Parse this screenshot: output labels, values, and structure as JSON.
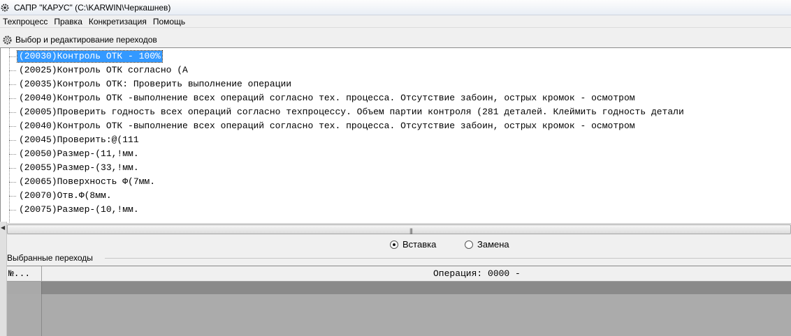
{
  "window": {
    "title": "САПР \"КАРУС\" (C:\\KARWIN\\Черкашнев)"
  },
  "menu": {
    "items": [
      "Техпроцесс",
      "Правка",
      "Конкретизация",
      "Помощь"
    ]
  },
  "panel": {
    "title": "Выбор и редактирование переходов"
  },
  "tree": {
    "rows": [
      "(20030)Контроль ОТК - 100%",
      "(20025)Контроль ОТК согласно (А",
      "(20035)Контроль ОТК: Проверить выполнение операции",
      "(20040)Контроль ОТК -выполнение всех операций согласно тех. процесса. Отсутствие забоин, острых кромок - осмотром",
      "(20005)Проверить годность всех операций согласно техпроцессу. Объем партии контроля (281 деталей. Клеймить годность детали",
      "(20040)Контроль ОТК -выполнение всех операций согласно тех. процесса. Отсутствие забоин, острых кромок - осмотром",
      "(20045)Проверить:@(111",
      "(20050)Размер-(11,!мм.",
      "(20055)Размер-(33,!мм.",
      "(20065)Поверхность Ф(7мм.",
      "(20070)Отв.Ф(8мм.",
      "(20075)Размер-(10,!мм."
    ],
    "selected_index": 0
  },
  "mode": {
    "insert_label": "Вставка",
    "replace_label": "Замена",
    "selected": "insert"
  },
  "selected_transitions": {
    "label": "Выбранные переходы",
    "col_number": "№...",
    "operation": "Операция: 0000 -"
  }
}
